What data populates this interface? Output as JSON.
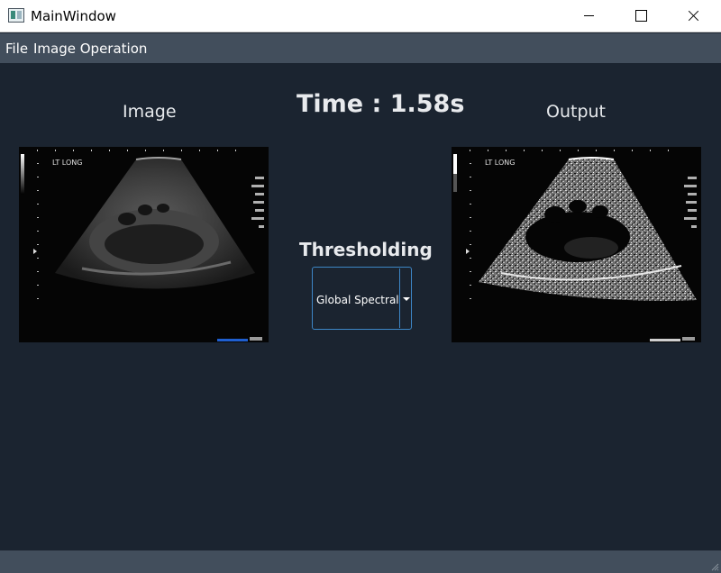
{
  "window": {
    "title": "MainWindow"
  },
  "menu": {
    "items": [
      "File",
      "Image Operation"
    ]
  },
  "panels": {
    "image_label": "Image",
    "output_label": "Output",
    "ultrasound_caption": "LT LONG"
  },
  "timing": {
    "text": "Time : 1.58s"
  },
  "thresholding": {
    "title": "Thresholding",
    "selected": "Global Spectral"
  },
  "colors": {
    "background": "#1b2430",
    "menubar": "#424e5c",
    "accent": "#3d86c6"
  }
}
